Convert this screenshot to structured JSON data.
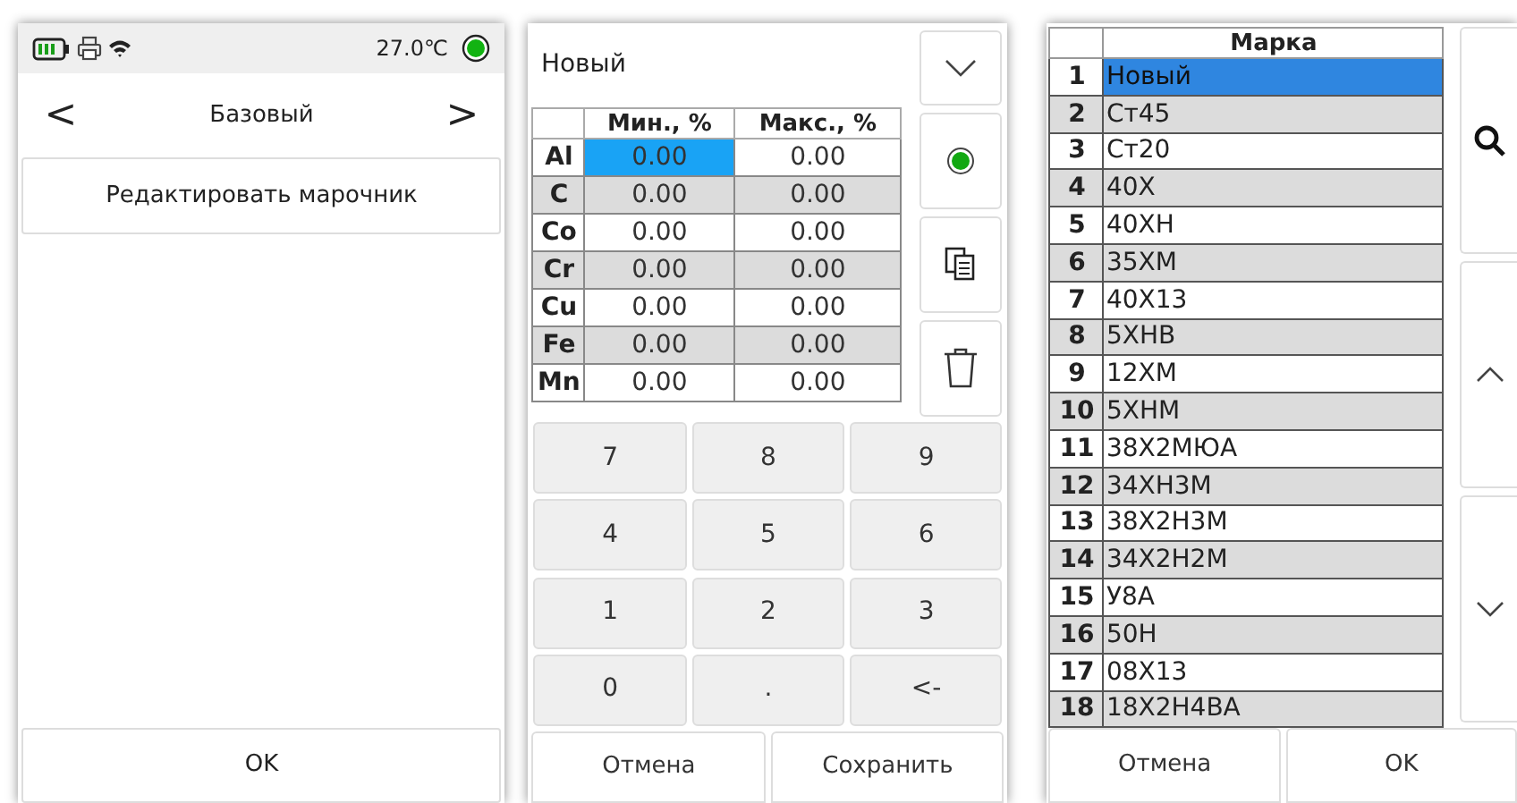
{
  "screen_1": {
    "status_bar": {
      "temperature": "27.0℃"
    },
    "nav": {
      "title": "Базовый",
      "prev": "<",
      "next": ">"
    },
    "menu": [
      "Редактировать марочник"
    ],
    "ok_button": "OK"
  },
  "screen_2": {
    "grade_name": "Новый",
    "table": {
      "columns": [
        "Мин., %",
        "Макс., %"
      ],
      "rows": [
        {
          "element": "Al",
          "cells": [
            {
              "text": "0.00",
              "selected": true
            },
            {
              "text": "0.00",
              "selected": false
            }
          ]
        },
        {
          "element": "C",
          "cells": [
            {
              "text": "0.00",
              "selected": false
            },
            {
              "text": "0.00",
              "selected": false
            }
          ]
        },
        {
          "element": "Co",
          "cells": [
            {
              "text": "0.00",
              "selected": false
            },
            {
              "text": "0.00",
              "selected": false
            }
          ]
        },
        {
          "element": "Cr",
          "cells": [
            {
              "text": "0.00",
              "selected": false
            },
            {
              "text": "0.00",
              "selected": false
            }
          ]
        },
        {
          "element": "Cu",
          "cells": [
            {
              "text": "0.00",
              "selected": false
            },
            {
              "text": "0.00",
              "selected": false
            }
          ]
        },
        {
          "element": "Fe",
          "cells": [
            {
              "text": "0.00",
              "selected": false
            },
            {
              "text": "0.00",
              "selected": false
            }
          ]
        },
        {
          "element": "Mn",
          "cells": [
            {
              "text": "0.00",
              "selected": false
            },
            {
              "text": "0.00",
              "selected": false
            }
          ]
        }
      ]
    },
    "indicator": {
      "checked": true
    },
    "keypad": [
      "7",
      "8",
      "9",
      "4",
      "5",
      "6",
      "1",
      "2",
      "3",
      "0",
      ".",
      "<-"
    ],
    "buttons": [
      "Отмена",
      "Сохранить"
    ]
  },
  "screen_3": {
    "table": {
      "column": "Марка",
      "rows": [
        {
          "index": "1",
          "grade": "Новый",
          "selected": true
        },
        {
          "index": "2",
          "grade": "Ст45",
          "selected": false
        },
        {
          "index": "3",
          "grade": "Ст20",
          "selected": false
        },
        {
          "index": "4",
          "grade": "40Х",
          "selected": false
        },
        {
          "index": "5",
          "grade": "40ХН",
          "selected": false
        },
        {
          "index": "6",
          "grade": "35ХМ",
          "selected": false
        },
        {
          "index": "7",
          "grade": "40Х13",
          "selected": false
        },
        {
          "index": "8",
          "grade": "5ХНВ",
          "selected": false
        },
        {
          "index": "9",
          "grade": "12ХМ",
          "selected": false
        },
        {
          "index": "10",
          "grade": "5ХНМ",
          "selected": false
        },
        {
          "index": "11",
          "grade": "38Х2МЮА",
          "selected": false
        },
        {
          "index": "12",
          "grade": "34ХН3М",
          "selected": false
        },
        {
          "index": "13",
          "grade": "38Х2Н3М",
          "selected": false
        },
        {
          "index": "14",
          "grade": "34Х2Н2М",
          "selected": false
        },
        {
          "index": "15",
          "grade": "У8А",
          "selected": false
        },
        {
          "index": "16",
          "grade": "50Н",
          "selected": false
        },
        {
          "index": "17",
          "grade": "08Х13",
          "selected": false
        },
        {
          "index": "18",
          "grade": "18Х2Н4ВА",
          "selected": false
        }
      ]
    },
    "buttons": [
      "Отмена",
      "OK"
    ]
  }
}
